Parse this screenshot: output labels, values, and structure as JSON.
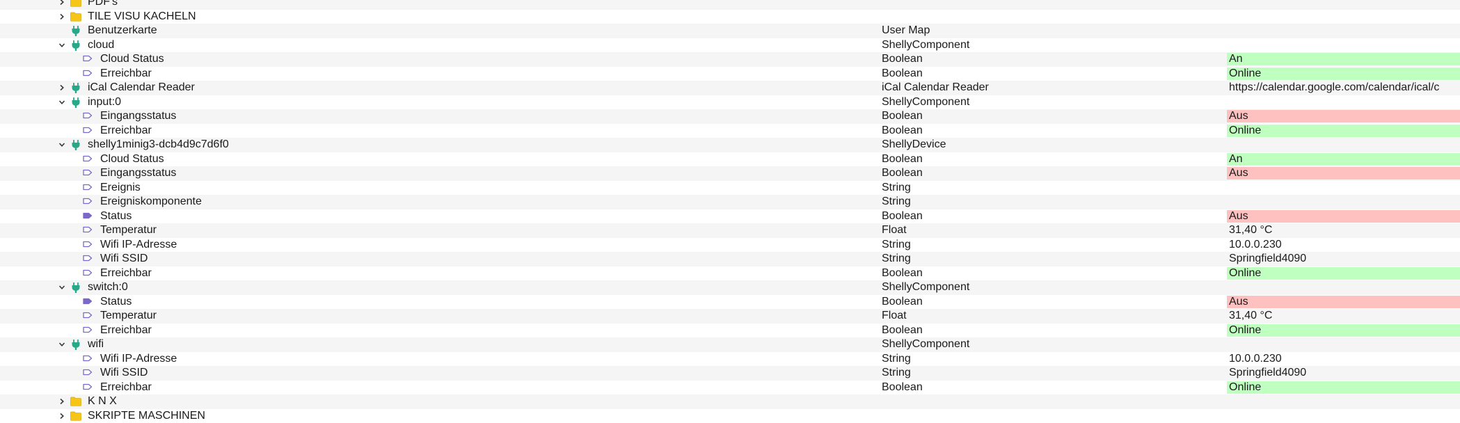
{
  "rows": [
    {
      "kind": "folder",
      "expanded": false,
      "level": 0,
      "name": "PDF's",
      "type": "",
      "value": "",
      "status": ""
    },
    {
      "kind": "folder",
      "expanded": false,
      "level": 0,
      "name": "TILE VISU KACHELN",
      "type": "",
      "value": "",
      "status": ""
    },
    {
      "kind": "plugin",
      "expanded": null,
      "level": 0,
      "name": "Benutzerkarte",
      "type": "User Map",
      "value": "",
      "status": ""
    },
    {
      "kind": "plugin",
      "expanded": true,
      "level": 0,
      "name": "cloud",
      "type": "ShellyComponent",
      "value": "",
      "status": ""
    },
    {
      "kind": "tag",
      "expanded": null,
      "level": 1,
      "name": "Cloud Status",
      "type": "Boolean",
      "value": "An",
      "status": "on"
    },
    {
      "kind": "tag",
      "expanded": null,
      "level": 1,
      "name": "Erreichbar",
      "type": "Boolean",
      "value": "Online",
      "status": "on"
    },
    {
      "kind": "plugin",
      "expanded": false,
      "level": 0,
      "name": "iCal Calendar Reader",
      "type": "iCal Calendar Reader",
      "value": "https://calendar.google.com/calendar/ical/c",
      "status": ""
    },
    {
      "kind": "plugin",
      "expanded": true,
      "level": 0,
      "name": "input:0",
      "type": "ShellyComponent",
      "value": "",
      "status": ""
    },
    {
      "kind": "tag",
      "expanded": null,
      "level": 1,
      "name": "Eingangsstatus",
      "type": "Boolean",
      "value": "Aus",
      "status": "off"
    },
    {
      "kind": "tag",
      "expanded": null,
      "level": 1,
      "name": "Erreichbar",
      "type": "Boolean",
      "value": "Online",
      "status": "on"
    },
    {
      "kind": "plugin",
      "expanded": true,
      "level": 0,
      "name": "shelly1minig3-dcb4d9c7d6f0",
      "type": "ShellyDevice",
      "value": "",
      "status": ""
    },
    {
      "kind": "tag",
      "expanded": null,
      "level": 1,
      "name": "Cloud Status",
      "type": "Boolean",
      "value": "An",
      "status": "on"
    },
    {
      "kind": "tag",
      "expanded": null,
      "level": 1,
      "name": "Eingangsstatus",
      "type": "Boolean",
      "value": "Aus",
      "status": "off"
    },
    {
      "kind": "tag",
      "expanded": null,
      "level": 1,
      "name": "Ereignis",
      "type": "String",
      "value": "",
      "status": ""
    },
    {
      "kind": "tag",
      "expanded": null,
      "level": 1,
      "name": "Ereigniskomponente",
      "type": "String",
      "value": "",
      "status": ""
    },
    {
      "kind": "tag-filled",
      "expanded": null,
      "level": 1,
      "name": "Status",
      "type": "Boolean",
      "value": "Aus",
      "status": "off"
    },
    {
      "kind": "tag",
      "expanded": null,
      "level": 1,
      "name": "Temperatur",
      "type": "Float",
      "value": "31,40 °C",
      "status": ""
    },
    {
      "kind": "tag",
      "expanded": null,
      "level": 1,
      "name": "Wifi IP-Adresse",
      "type": "String",
      "value": "10.0.0.230",
      "status": ""
    },
    {
      "kind": "tag",
      "expanded": null,
      "level": 1,
      "name": "Wifi SSID",
      "type": "String",
      "value": "Springfield4090",
      "status": ""
    },
    {
      "kind": "tag",
      "expanded": null,
      "level": 1,
      "name": "Erreichbar",
      "type": "Boolean",
      "value": "Online",
      "status": "on"
    },
    {
      "kind": "plugin",
      "expanded": true,
      "level": 0,
      "name": "switch:0",
      "type": "ShellyComponent",
      "value": "",
      "status": ""
    },
    {
      "kind": "tag-filled",
      "expanded": null,
      "level": 1,
      "name": "Status",
      "type": "Boolean",
      "value": "Aus",
      "status": "off"
    },
    {
      "kind": "tag",
      "expanded": null,
      "level": 1,
      "name": "Temperatur",
      "type": "Float",
      "value": "31,40 °C",
      "status": ""
    },
    {
      "kind": "tag",
      "expanded": null,
      "level": 1,
      "name": "Erreichbar",
      "type": "Boolean",
      "value": "Online",
      "status": "on"
    },
    {
      "kind": "plugin",
      "expanded": true,
      "level": 0,
      "name": "wifi",
      "type": "ShellyComponent",
      "value": "",
      "status": ""
    },
    {
      "kind": "tag",
      "expanded": null,
      "level": 1,
      "name": "Wifi IP-Adresse",
      "type": "String",
      "value": "10.0.0.230",
      "status": ""
    },
    {
      "kind": "tag",
      "expanded": null,
      "level": 1,
      "name": "Wifi SSID",
      "type": "String",
      "value": "Springfield4090",
      "status": ""
    },
    {
      "kind": "tag",
      "expanded": null,
      "level": 1,
      "name": "Erreichbar",
      "type": "Boolean",
      "value": "Online",
      "status": "on"
    },
    {
      "kind": "folder",
      "expanded": false,
      "level": 0,
      "name": "K N X",
      "type": "",
      "value": "",
      "status": ""
    },
    {
      "kind": "folder",
      "expanded": false,
      "level": 0,
      "name": "SKRIPTE MASCHINEN",
      "type": "",
      "value": "",
      "status": ""
    }
  ],
  "icons": {
    "folder": "folder-icon",
    "plugin": "plugin-icon",
    "tag": "tag-outline-icon",
    "tag-filled": "tag-filled-icon",
    "expanded": "chevron-down-icon",
    "collapsed": "chevron-right-icon"
  },
  "colors": {
    "status_on": "#bfffbf",
    "status_off": "#ffc0c0",
    "folder": "#f5c518",
    "plugin": "#27a889",
    "tag": "#7b68c8"
  }
}
